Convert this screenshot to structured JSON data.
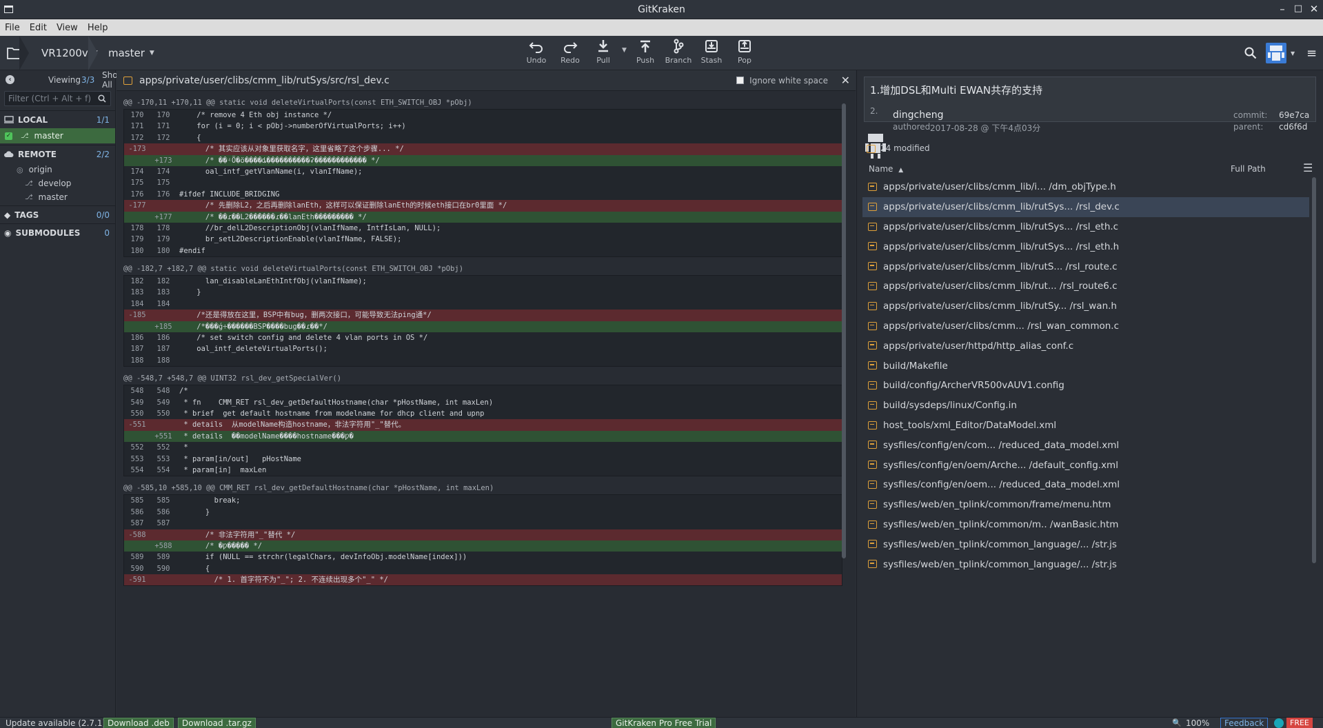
{
  "window": {
    "title": "GitKraken"
  },
  "menu": [
    "File",
    "Edit",
    "View",
    "Help"
  ],
  "toolbar": {
    "repo": "VR1200v",
    "branch": "master",
    "buttons": [
      {
        "label": "Undo",
        "icon": "undo-icon"
      },
      {
        "label": "Redo",
        "icon": "redo-icon"
      },
      {
        "label": "Pull",
        "icon": "pull-icon"
      },
      {
        "label": "Push",
        "icon": "push-icon"
      },
      {
        "label": "Branch",
        "icon": "branch-icon"
      },
      {
        "label": "Stash",
        "icon": "stash-icon"
      },
      {
        "label": "Pop",
        "icon": "pop-icon"
      }
    ]
  },
  "sidebar": {
    "viewing_label": "Viewing",
    "viewing_count": "3/3",
    "show_all": "Show All",
    "filter_placeholder": "Filter (Ctrl + Alt + f)",
    "local": {
      "label": "LOCAL",
      "count": "1/1",
      "branches": [
        "master"
      ]
    },
    "remote": {
      "label": "REMOTE",
      "count": "2/2",
      "remote_name": "origin",
      "branches": [
        "develop",
        "master"
      ]
    },
    "tags": {
      "label": "TAGS",
      "count": "0/0"
    },
    "submodules": {
      "label": "SUBMODULES",
      "count": "0"
    }
  },
  "diff": {
    "path": "apps/private/user/clibs/cmm_lib/rutSys/src/rsl_dev.c",
    "ignore_ws": "Ignore white space",
    "hunks": [
      {
        "header": "@@ -170,11 +170,11 @@ static void deleteVirtualPorts(const ETH_SWITCH_OBJ *pObj)",
        "lines": [
          {
            "t": "ctx",
            "a": "170",
            "b": "170",
            "c": "    /* remove 4 Eth obj instance */"
          },
          {
            "t": "ctx",
            "a": "171",
            "b": "171",
            "c": "    for (i = 0; i < pObj->numberOfVirtualPorts; i++)"
          },
          {
            "t": "ctx",
            "a": "172",
            "b": "172",
            "c": "    {"
          },
          {
            "t": "del",
            "a": "-173",
            "b": "",
            "c": "      /* 其实应该从对象里获取名字，这里省略了这个步骤... */"
          },
          {
            "t": "add",
            "a": "",
            "b": "+173",
            "c": "      /* ��ʵӦ�ö����ȡ����������ʡ������������ */"
          },
          {
            "t": "ctx",
            "a": "174",
            "b": "174",
            "c": "      oal_intf_getVlanName(i, vlanIfName);"
          },
          {
            "t": "ctx",
            "a": "175",
            "b": "175",
            "c": ""
          },
          {
            "t": "ctx",
            "a": "176",
            "b": "176",
            "c": "#ifdef INCLUDE_BRIDGING"
          },
          {
            "t": "del",
            "a": "-177",
            "b": "",
            "c": "      /* 先删除L2，之后再删除lanEth，这样可以保证删除lanEth的时候eth接口在br0里面 */"
          },
          {
            "t": "add",
            "a": "",
            "b": "+177",
            "c": "      /* ��ɾ��L2��֮����ɾ��lanEth��������� */"
          },
          {
            "t": "ctx",
            "a": "178",
            "b": "178",
            "c": "      //br_delL2DescriptionObj(vlanIfName, IntfIsLan, NULL);"
          },
          {
            "t": "ctx",
            "a": "179",
            "b": "179",
            "c": "      br_setL2DescriptionEnable(vlanIfName, FALSE);"
          },
          {
            "t": "ctx",
            "a": "180",
            "b": "180",
            "c": "#endif"
          }
        ]
      },
      {
        "header": "@@ -182,7 +182,7 @@ static void deleteVirtualPorts(const ETH_SWITCH_OBJ *pObj)",
        "lines": [
          {
            "t": "ctx",
            "a": "182",
            "b": "182",
            "c": "      lan_disableLanEthIntfObj(vlanIfName);"
          },
          {
            "t": "ctx",
            "a": "183",
            "b": "183",
            "c": "    }"
          },
          {
            "t": "ctx",
            "a": "184",
            "b": "184",
            "c": ""
          },
          {
            "t": "del",
            "a": "-185",
            "b": "",
            "c": "    /*还是得放在这里，BSP中有bug，删两次接口，可能导致无法ping通*/"
          },
          {
            "t": "add",
            "a": "",
            "b": "+185",
            "c": "    /*���ǵ÷������BSP����bug��ɾ��*/"
          },
          {
            "t": "ctx",
            "a": "186",
            "b": "186",
            "c": "    /* set switch config and delete 4 vlan ports in OS */"
          },
          {
            "t": "ctx",
            "a": "187",
            "b": "187",
            "c": "    oal_intf_deleteVirtualPorts();"
          },
          {
            "t": "ctx",
            "a": "188",
            "b": "188",
            "c": ""
          }
        ]
      },
      {
        "header": "@@ -548,7 +548,7 @@ UINT32 rsl_dev_getSpecialVer()",
        "lines": [
          {
            "t": "ctx",
            "a": "548",
            "b": "548",
            "c": "/*"
          },
          {
            "t": "ctx",
            "a": "549",
            "b": "549",
            "c": " * fn    CMM_RET rsl_dev_getDefaultHostname(char *pHostName, int maxLen)"
          },
          {
            "t": "ctx",
            "a": "550",
            "b": "550",
            "c": " * brief  get default hostname from modelname for dhcp client and upnp"
          },
          {
            "t": "del",
            "a": "-551",
            "b": "",
            "c": " * details  从modelName构造hostname，非法字符用\"_\"替代。"
          },
          {
            "t": "add",
            "a": "",
            "b": "+551",
            "c": " * details  ��modelName����hostname���Ƿ�"
          },
          {
            "t": "ctx",
            "a": "552",
            "b": "552",
            "c": " *"
          },
          {
            "t": "ctx",
            "a": "553",
            "b": "553",
            "c": " * param[in/out]   pHostName"
          },
          {
            "t": "ctx",
            "a": "554",
            "b": "554",
            "c": " * param[in]  maxLen"
          }
        ]
      },
      {
        "header": "@@ -585,10 +585,10 @@ CMM_RET rsl_dev_getDefaultHostname(char *pHostName, int maxLen)",
        "lines": [
          {
            "t": "ctx",
            "a": "585",
            "b": "585",
            "c": "        break;"
          },
          {
            "t": "ctx",
            "a": "586",
            "b": "586",
            "c": "      }"
          },
          {
            "t": "ctx",
            "a": "587",
            "b": "587",
            "c": ""
          },
          {
            "t": "del",
            "a": "-588",
            "b": "",
            "c": "      /* 非法字符用\"_\"替代 */"
          },
          {
            "t": "add",
            "a": "",
            "b": "+588",
            "c": "      /* �Ƿ��ַ��� */"
          },
          {
            "t": "ctx",
            "a": "589",
            "b": "589",
            "c": "      if (NULL == strchr(legalChars, devInfoObj.modelName[index]))"
          },
          {
            "t": "ctx",
            "a": "590",
            "b": "590",
            "c": "      {"
          },
          {
            "t": "del",
            "a": "-591",
            "b": "",
            "c": "        /* 1. 首字符不为\"_\"; 2. 不连续出现多个\"_\" */"
          }
        ]
      }
    ]
  },
  "commit": {
    "title": "1.增加DSL和Multi EWAN共存的支持",
    "body": "2.",
    "author": "dingcheng",
    "authored_label": "authored",
    "date": "2017-08-28 @ 下午4点03分",
    "commit_label": "commit:",
    "commit_hash": "69e7ca",
    "parent_label": "parent:",
    "parent_hash": "cd6f6d",
    "modified": "24 modified",
    "sort_name": "Name",
    "full_path": "Full Path",
    "files": [
      "apps/private/user/clibs/cmm_lib/i... /dm_objType.h",
      "apps/private/user/clibs/cmm_lib/rutSys... /rsl_dev.c",
      "apps/private/user/clibs/cmm_lib/rutSys... /rsl_eth.c",
      "apps/private/user/clibs/cmm_lib/rutSys... /rsl_eth.h",
      "apps/private/user/clibs/cmm_lib/rutS... /rsl_route.c",
      "apps/private/user/clibs/cmm_lib/rut... /rsl_route6.c",
      "apps/private/user/clibs/cmm_lib/rutSy... /rsl_wan.h",
      "apps/private/user/clibs/cmm... /rsl_wan_common.c",
      "apps/private/user/httpd/http_alias_conf.c",
      "build/Makefile",
      "build/config/ArcherVR500vAUV1.config",
      "build/sysdeps/linux/Config.in",
      "host_tools/xml_Editor/DataModel.xml",
      "sysfiles/config/en/com... /reduced_data_model.xml",
      "sysfiles/config/en/oem/Arche... /default_config.xml",
      "sysfiles/config/en/oem... /reduced_data_model.xml",
      "sysfiles/web/en_tplink/common/frame/menu.htm",
      "sysfiles/web/en_tplink/common/m.. /wanBasic.htm",
      "sysfiles/web/en_tplink/common_language/... /str.js",
      "sysfiles/web/en_tplink/common_language/... /str.js"
    ]
  },
  "status": {
    "update": "Update available (2.7.1)",
    "download_deb": "Download .deb",
    "download_tar": "Download .tar.gz",
    "trial": "GitKraken Pro Free Trial",
    "zoom": "100%",
    "feedback": "Feedback",
    "free": "FREE"
  }
}
